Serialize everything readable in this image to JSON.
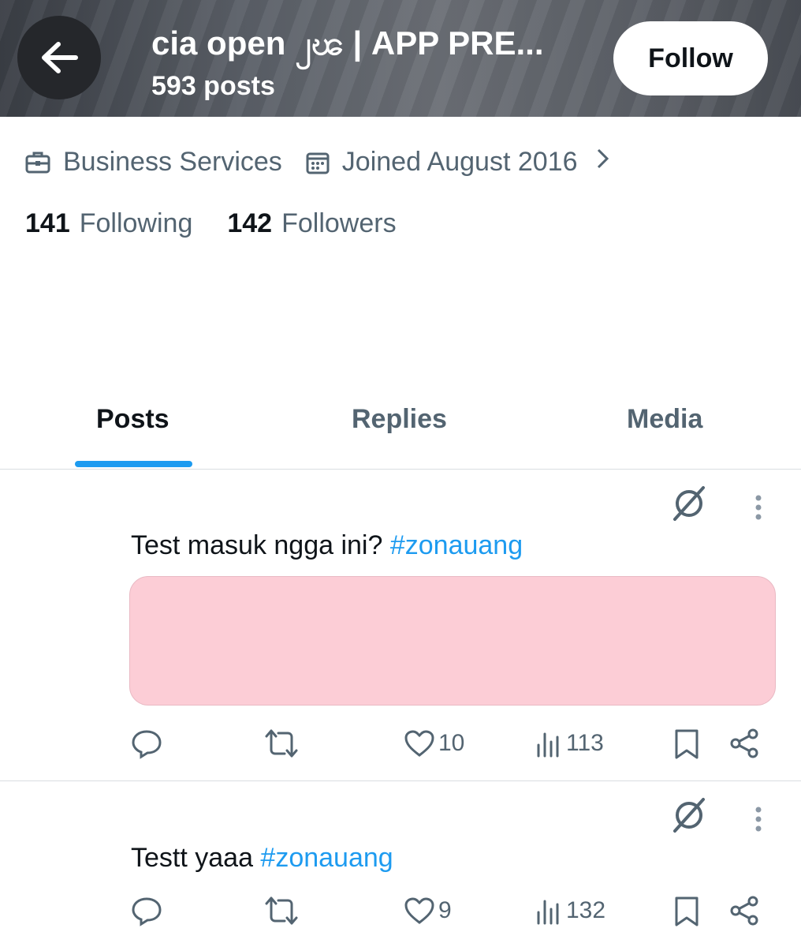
{
  "header": {
    "title": "cia open ၂ၽ | APP PRE...",
    "posts_count": "593 posts",
    "follow_label": "Follow"
  },
  "profile": {
    "category": "Business Services",
    "joined": "Joined August 2016",
    "following_count": "141",
    "following_label": "Following",
    "followers_count": "142",
    "followers_label": "Followers"
  },
  "tabs": [
    {
      "label": "Posts",
      "active": true
    },
    {
      "label": "Replies",
      "active": false
    },
    {
      "label": "Media",
      "active": false
    }
  ],
  "posts": [
    {
      "text": "Test masuk ngga ini? ",
      "hashtag": "#zonauang",
      "likes": "10",
      "views": "113",
      "media_color": "#fccdd6"
    },
    {
      "text": "Testt yaaa ",
      "hashtag": "#zonauang",
      "likes": "9",
      "views": "132"
    }
  ],
  "icons": [
    "back-arrow-icon",
    "briefcase-icon",
    "calendar-icon",
    "chevron-right-icon",
    "grok-icon",
    "more-icon",
    "reply-icon",
    "retweet-icon",
    "like-icon",
    "views-icon",
    "bookmark-icon",
    "share-icon"
  ],
  "colors": {
    "accent": "#1d9bf0",
    "muted_text": "#536471",
    "media_placeholder": "#fccdd6"
  }
}
